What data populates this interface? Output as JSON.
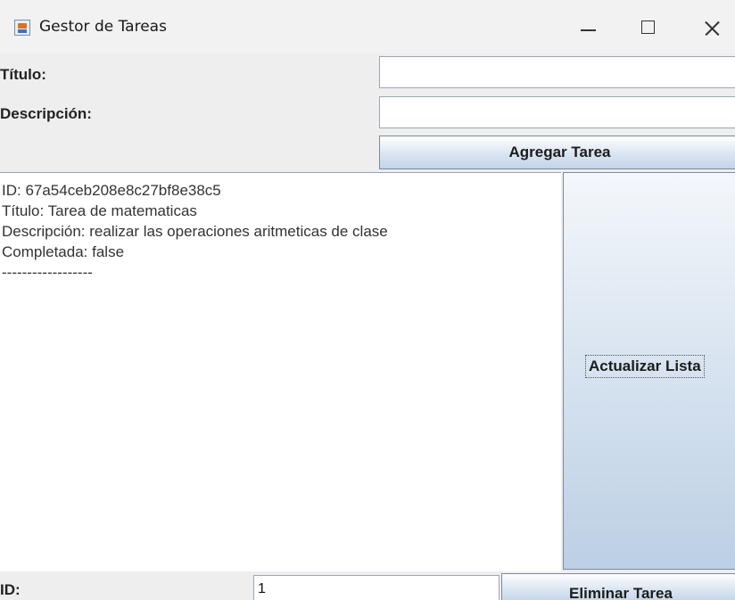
{
  "window": {
    "title": "Gestor de Tareas",
    "icon": "java-coffee-icon",
    "controls": {
      "minimize": "minimize-icon",
      "maximize": "maximize-icon",
      "close": "close-icon"
    }
  },
  "form": {
    "titulo_label": "Título:",
    "titulo_value": "",
    "descripcion_label": "Descripción:",
    "descripcion_value": "",
    "add_button": "Agregar Tarea"
  },
  "task_list": {
    "lines": [
      "ID: 67a54ceb208e8c27bf8e38c5",
      "Título: Tarea de matematicas",
      "Descripción: realizar las operaciones aritmeticas de clase",
      "Completada: false",
      "------------------"
    ]
  },
  "refresh_button": "Actualizar Lista",
  "delete_section": {
    "id_label": "ID:",
    "id_value": "1",
    "delete_button": "Eliminar Tarea"
  }
}
